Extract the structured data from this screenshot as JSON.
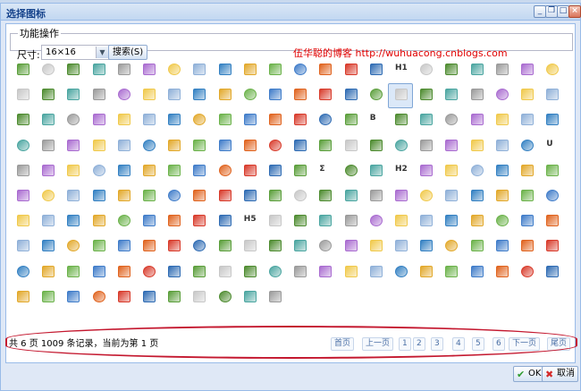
{
  "dialog": {
    "title": "选择图标",
    "controls": {
      "minimize": "_",
      "restore": "❐",
      "maximize": "□",
      "close": "×"
    }
  },
  "toolbar": {
    "legend": "功能操作",
    "size_label": "尺寸:",
    "size_value": "16×16",
    "search_label": "搜索(S)",
    "blog_text": "伍华聪的博客 http://wuhuacong.cnblogs.com"
  },
  "icons": {
    "colors": [
      "#5a9e3a",
      "#d83a2a",
      "#3f7cc9",
      "#e2a82a",
      "#8fb0d8",
      "#a96bd0",
      "#4aa5a0",
      "#c7c7c7",
      "#2e6bb3",
      "#e0631e",
      "#6bb24a",
      "#3380c2",
      "#f0c94b",
      "#9a9a9a",
      "#4d8b2f"
    ],
    "rows": [
      22,
      22,
      22,
      22,
      22,
      22,
      22,
      22,
      22,
      11
    ],
    "selected_index": 37,
    "text_icons": {
      "15": "H1",
      "58": "B",
      "100": "Σ",
      "103": "H2",
      "141": "H5",
      "87": "U"
    }
  },
  "pager": {
    "summary": "共 6 页 1009 条记录，当前为第 1 页",
    "first": "首页",
    "prev": "上一页",
    "pages": [
      "1",
      "2",
      "3",
      "4",
      "5",
      "6"
    ],
    "next": "下一页",
    "last": "尾页"
  },
  "footer": {
    "ok_label": "OK",
    "cancel_label": "取消"
  }
}
